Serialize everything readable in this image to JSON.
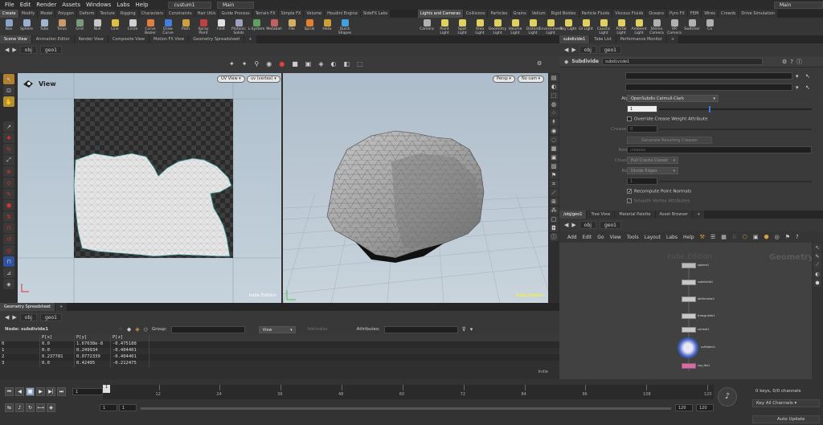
{
  "menubar": {
    "items": [
      "File",
      "Edit",
      "Render",
      "Assets",
      "Windows",
      "Labs",
      "Help"
    ],
    "desktop": "custum1",
    "context_left": "Main",
    "context_right": "Main"
  },
  "shelf_tabs_left": [
    "Create",
    "Modify",
    "Model",
    "Polygon",
    "Deform",
    "Texture",
    "Rigging",
    "Characters",
    "Constraints",
    "Hair Utils",
    "Guide Process",
    "Terrain FX",
    "Simple FX",
    "Volume",
    "Houdini Engine",
    "SideFX Labs"
  ],
  "shelf_tabs_right": [
    "Lights and Cameras",
    "Collisions",
    "Particles",
    "Grains",
    "Vellum",
    "Rigid Bodies",
    "Particle Fluids",
    "Viscous Fluids",
    "Oceans",
    "Pyro FX",
    "FEM",
    "Wires",
    "Crowds",
    "Drive Simulation"
  ],
  "shelf_tools_left": [
    {
      "label": "Box",
      "color": "#8aa4c8"
    },
    {
      "label": "Sphere",
      "color": "#9ab0d0"
    },
    {
      "label": "Tube",
      "color": "#a0b4cc"
    },
    {
      "label": "Torus",
      "color": "#c89a6a"
    },
    {
      "label": "Grid",
      "color": "#7a9a7a"
    },
    {
      "label": "Null",
      "color": "#c8c8c8"
    },
    {
      "label": "Line",
      "color": "#e0c040"
    },
    {
      "label": "Circle",
      "color": "#d0d0d0"
    },
    {
      "label": "Curve Bezier",
      "color": "#e08040"
    },
    {
      "label": "Draw Curve",
      "color": "#4080e0"
    },
    {
      "label": "Path",
      "color": "#d0a040"
    },
    {
      "label": "Spray Paint",
      "color": "#c04040"
    },
    {
      "label": "Font",
      "color": "#e0e0e0"
    },
    {
      "label": "Platonic Solids",
      "color": "#a0a0c0"
    },
    {
      "label": "L-System",
      "color": "#60a060"
    },
    {
      "label": "Metaball",
      "color": "#c06060"
    },
    {
      "label": "File",
      "color": "#d0b060"
    },
    {
      "label": "Spiral",
      "color": "#e08030"
    },
    {
      "label": "Helix",
      "color": "#d0a030"
    },
    {
      "label": "Quick Shapes",
      "color": "#40a0e0"
    }
  ],
  "shelf_tools_right": [
    {
      "label": "Camera",
      "color": "#b0b0b0"
    },
    {
      "label": "Point Light",
      "color": "#e0d060"
    },
    {
      "label": "Spot Light",
      "color": "#e0d060"
    },
    {
      "label": "Area Light",
      "color": "#e0d060"
    },
    {
      "label": "Geometry Light",
      "color": "#e0d060"
    },
    {
      "label": "Volume Light",
      "color": "#e0d060"
    },
    {
      "label": "Distant Light",
      "color": "#e0d060"
    },
    {
      "label": "Environment Light",
      "color": "#e0d060"
    },
    {
      "label": "Sky Light",
      "color": "#e0d060"
    },
    {
      "label": "GI Light",
      "color": "#e0d060"
    },
    {
      "label": "Caustic Light",
      "color": "#e0d060"
    },
    {
      "label": "Portal Light",
      "color": "#e0d060"
    },
    {
      "label": "Ambient Light",
      "color": "#e0d060"
    },
    {
      "label": "Stereo Camera",
      "color": "#b0b0b0"
    },
    {
      "label": "VR Camera",
      "color": "#b0b0b0"
    },
    {
      "label": "Switcher",
      "color": "#b0b0b0"
    },
    {
      "label": "Ca",
      "color": "#b0b0b0"
    }
  ],
  "left_pane_tabs": [
    "Scene View",
    "Animation Editor",
    "Render View",
    "Composite View",
    "Motion FX View",
    "Geometry Spreadsheet"
  ],
  "right_pane_tabs": [
    "subdivide1",
    "Take List",
    "Performance Monitor"
  ],
  "nav": {
    "obj": "obj",
    "geo": "geo1"
  },
  "uv_view": {
    "title": "View",
    "view_menu": "UV View",
    "attr_menu": "uv (vertex)",
    "watermark": "Indie Edition"
  },
  "view3d": {
    "persp": "Persp",
    "cam": "No cam",
    "watermark": "Indie Edition"
  },
  "params": {
    "node_type": "Subdivide",
    "node_name": "subdivide1",
    "group_label": "Group",
    "creases_label": "Creases",
    "algorithm_label": "Algorithm",
    "algorithm_value": "OpenSubdiv Catmull-Clark",
    "depth_label": "Depth",
    "depth_value": "1",
    "override_label": "Override Crease Weight Attribute",
    "crease_weight_label": "Crease Weight",
    "crease_weight_value": "0",
    "gen_creases_label": "Generate Resulting Creases",
    "new_group_label": "New Group",
    "new_group_value": "creases",
    "close_cracks_label": "Close Cracks",
    "close_cracks_value": "Pull Cracks Closed",
    "boundary_label": "Boundary",
    "boundary_value": "Divide Edges",
    "bias_label": "Bias",
    "bias_value": "1",
    "recompute_label": "Recompute Point Normals",
    "smooth_label": "Smooth Vertex Attributes"
  },
  "network": {
    "tabs": [
      "/obj/geo1",
      "Tree View",
      "Material Palette",
      "Asset Browser"
    ],
    "menu": [
      "Add",
      "Edit",
      "Go",
      "View",
      "Tools",
      "Layout",
      "Labs",
      "Help"
    ],
    "watermark": "Indie Edition",
    "context": "Geometry",
    "nodes": [
      "sphere1",
      "subdivide1",
      "attribnoise1",
      "triangulate1",
      "normal1",
      "uvflatten1",
      "rop_fbx1"
    ]
  },
  "spreadsheet": {
    "tab": "Geometry Spreadsheet",
    "node_label": "Node: subdivide1",
    "group_label": "Group:",
    "view_label": "View",
    "intrinsics_label": "Intrinsics",
    "attributes_label": "Attributes:",
    "columns": [
      "",
      "P[x]",
      "P[y]",
      "P[z]"
    ],
    "rows": [
      [
        "0",
        "0.0",
        "1.67638e-8",
        "-0.475188"
      ],
      [
        "1",
        "0.0",
        "0.249934",
        "-0.404401"
      ],
      [
        "2",
        "0.237781",
        "0.0772339",
        "-0.404401"
      ],
      [
        "3",
        "0.0",
        "0.42495",
        "-0.212475"
      ]
    ],
    "indie": "Indie"
  },
  "timeline": {
    "frame": "1",
    "ticks": [
      "1",
      "12",
      "24",
      "36",
      "48",
      "60",
      "72",
      "84",
      "96",
      "108",
      "120"
    ],
    "start": "1",
    "start2": "1",
    "end": "120",
    "end2": "120",
    "keys": "0 keys, 0/0 channels",
    "key_all": "Key All Channels",
    "auto_update": "Auto Update"
  }
}
